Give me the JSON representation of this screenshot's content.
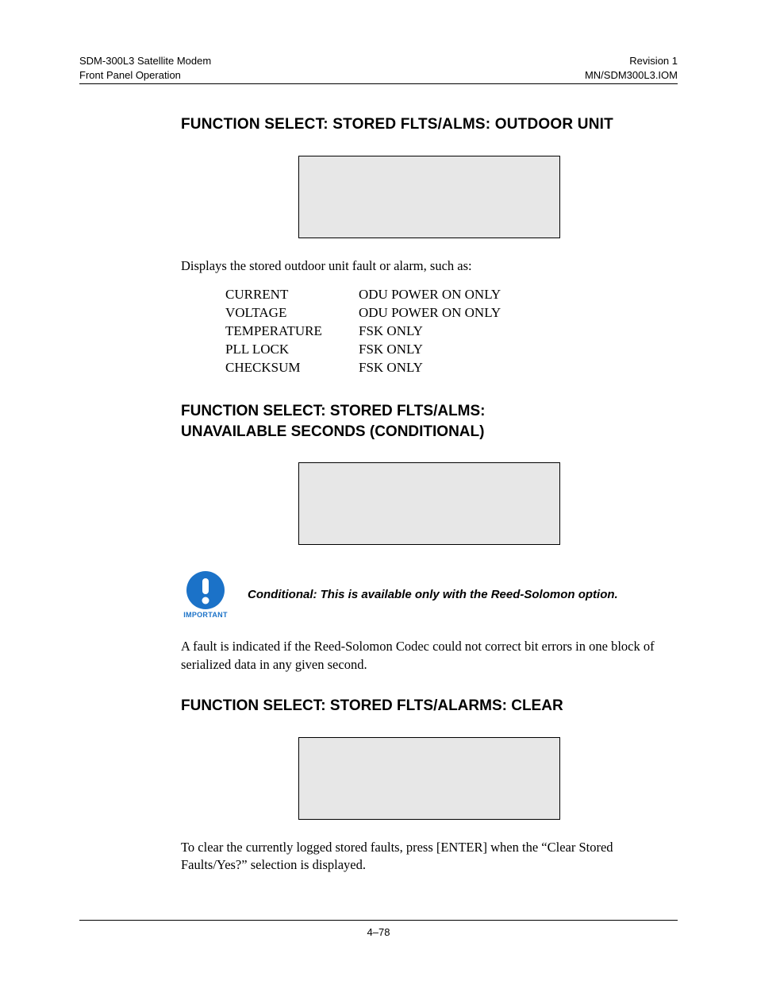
{
  "header": {
    "left_line1": "SDM-300L3 Satellite Modem",
    "left_line2": "Front Panel Operation",
    "right_line1": "Revision 1",
    "right_line2": "MN/SDM300L3.IOM"
  },
  "section1": {
    "heading": "FUNCTION SELECT: STORED FLTS/ALMS: OUTDOOR UNIT",
    "intro": "Displays the stored outdoor unit fault or alarm, such as:",
    "faults": [
      {
        "name": "CURRENT",
        "cond": "ODU POWER ON ONLY"
      },
      {
        "name": "VOLTAGE",
        "cond": "ODU POWER ON ONLY"
      },
      {
        "name": "TEMPERATURE",
        "cond": "FSK ONLY"
      },
      {
        "name": "PLL LOCK",
        "cond": "FSK ONLY"
      },
      {
        "name": "CHECKSUM",
        "cond": "FSK ONLY"
      }
    ]
  },
  "section2": {
    "heading_line1": "FUNCTION SELECT: STORED FLTS/ALMS:",
    "heading_line2": "UNAVAILABLE SECONDS (CONDITIONAL)",
    "note_label": "IMPORTANT",
    "note_text": "Conditional: This is available only with the Reed-Solomon option.",
    "para": "A fault is indicated if the Reed-Solomon Codec could not correct bit errors in one block of serialized data in any given second."
  },
  "section3": {
    "heading": "FUNCTION SELECT: STORED FLTS/ALARMS: CLEAR",
    "para": "To clear the currently logged stored faults, press [ENTER] when the “Clear Stored Faults/Yes?” selection is displayed."
  },
  "footer": {
    "page": "4–78"
  }
}
